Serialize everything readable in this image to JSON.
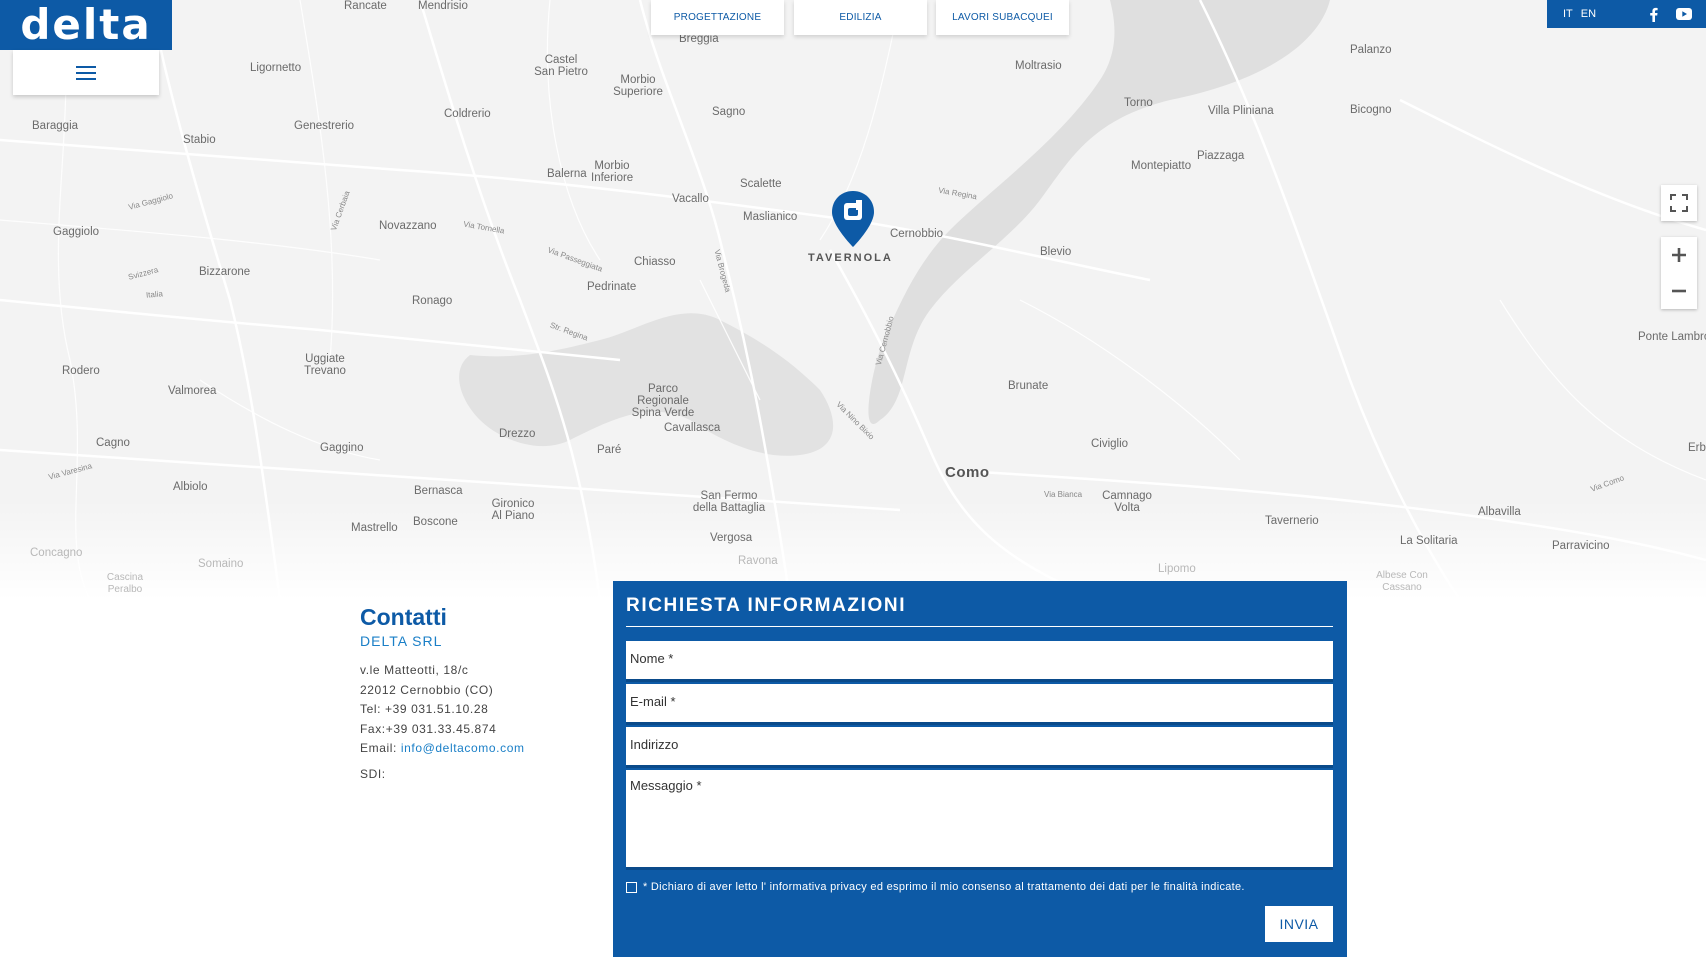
{
  "header": {
    "logo_text": "delta",
    "nav": [
      "PROGETTAZIONE",
      "EDILIZIA",
      "LAVORI SUBACQUEI"
    ],
    "languages": [
      "IT",
      "EN"
    ],
    "social": [
      "facebook-icon",
      "youtube-icon"
    ]
  },
  "map": {
    "marker_label": "TAVERNOLA",
    "places": [
      "Rancate",
      "Mendrisio",
      "Breggia",
      "Moltrasio",
      "Palanzo",
      "Ligornetto",
      "Castel San Pietro",
      "Morbio Superiore",
      "Coldrerio",
      "Torno",
      "Villa Pliniana",
      "Bicogno",
      "Baraggia",
      "Stabio",
      "Genestrerio",
      "Sagno",
      "Montepiatto",
      "Piazzaga",
      "Balerna",
      "Morbio Inferiore",
      "Scalette",
      "Vacallo",
      "Maslianico",
      "Cernobbio",
      "Gaggiolo",
      "Novazzano",
      "Chiasso",
      "Blevio",
      "Bizzarone",
      "Pedrinate",
      "Ronago",
      "Uggiate Trevano",
      "Rodero",
      "Valmorea",
      "Brunate",
      "Ponte Lambro",
      "Parco Regionale Spina Verde",
      "Cavallasca",
      "Drezzo",
      "Paré",
      "Como",
      "Civiglio",
      "Cagno",
      "Gaggino",
      "Albiolo",
      "Bernasca",
      "Gironico Al Piano",
      "San Fermo della Battaglia",
      "Camnago Volta",
      "Tavernerio",
      "Albavilla",
      "Mastrello",
      "Boscone",
      "Vergosa",
      "La Solitaria",
      "Parravicino",
      "Concagno",
      "Somaino",
      "Erb",
      "Cascina Peralbo",
      "Lipomo",
      "Albese Con Cassano",
      "Ravona",
      "Cernobbio"
    ],
    "roads": [
      "Via Gaggiolo",
      "Via Tornella",
      "Via Passeggiata",
      "Via Brogeda",
      "Via Cernobbio",
      "Via Nino Bixio",
      "Via Regina",
      "Via Varesina",
      "Via Bianca",
      "Via Como",
      "Svizzera",
      "Italia",
      "Str. Regina",
      "Via Cerbaia"
    ]
  },
  "contacts": {
    "title": "Contatti",
    "company": "DELTA SRL",
    "address": "v.le Matteotti, 18/c",
    "city": "22012 Cernobbio (CO)",
    "tel": "Tel: +39 031.51.10.28",
    "fax": "Fax:+39 031.33.45.874",
    "email_label": "Email: ",
    "email": "info@deltacomo.com",
    "sdi": "SDI:"
  },
  "form": {
    "title": "RICHIESTA INFORMAZIONI",
    "name_placeholder": "Nome *",
    "email_placeholder": "E-mail *",
    "address_placeholder": "Indirizzo",
    "message_placeholder": "Messaggio *",
    "privacy": "* Dichiaro di aver letto l' informativa privacy ed esprimo il mio consenso al trattamento dei dati per le finalità indicate.",
    "submit": "INVIA"
  },
  "colors": {
    "brand": "#0d5aa6",
    "link": "#1a7fc7",
    "map_bg": "#f3f3f3",
    "lake": "#dedede"
  }
}
